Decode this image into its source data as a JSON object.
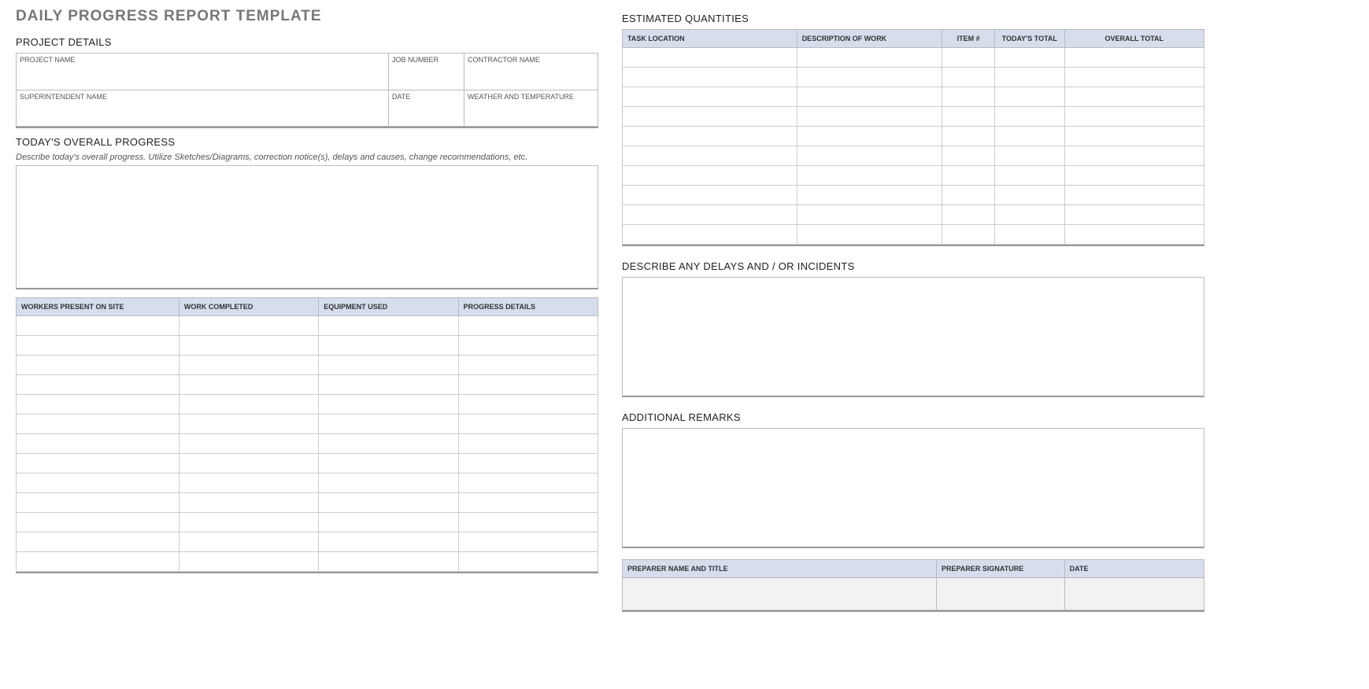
{
  "title": "DAILY PROGRESS REPORT TEMPLATE",
  "project_details": {
    "heading": "PROJECT DETAILS",
    "labels": {
      "project_name": "PROJECT NAME",
      "job_number": "JOB NUMBER",
      "contractor_name": "CONTRACTOR NAME",
      "superintendent_name": "SUPERINTENDENT NAME",
      "date": "DATE",
      "weather": "WEATHER AND TEMPERATURE"
    },
    "values": {
      "project_name": "",
      "job_number": "",
      "contractor_name": "",
      "superintendent_name": "",
      "date": "",
      "weather": ""
    }
  },
  "overall_progress": {
    "heading": "TODAY'S OVERALL PROGRESS",
    "instruction": "Describe today's overall progress.  Utilize Sketches/Diagrams, correction notice(s), delays and causes, change recommendations, etc.",
    "value": ""
  },
  "progress_table": {
    "headers": {
      "workers": "WORKERS PRESENT ON SITE",
      "completed": "WORK COMPLETED",
      "equipment": "EQUIPMENT USED",
      "details": "PROGRESS DETAILS"
    },
    "rows": [
      {
        "workers": "",
        "completed": "",
        "equipment": "",
        "details": ""
      },
      {
        "workers": "",
        "completed": "",
        "equipment": "",
        "details": ""
      },
      {
        "workers": "",
        "completed": "",
        "equipment": "",
        "details": ""
      },
      {
        "workers": "",
        "completed": "",
        "equipment": "",
        "details": ""
      },
      {
        "workers": "",
        "completed": "",
        "equipment": "",
        "details": ""
      },
      {
        "workers": "",
        "completed": "",
        "equipment": "",
        "details": ""
      },
      {
        "workers": "",
        "completed": "",
        "equipment": "",
        "details": ""
      },
      {
        "workers": "",
        "completed": "",
        "equipment": "",
        "details": ""
      },
      {
        "workers": "",
        "completed": "",
        "equipment": "",
        "details": ""
      },
      {
        "workers": "",
        "completed": "",
        "equipment": "",
        "details": ""
      },
      {
        "workers": "",
        "completed": "",
        "equipment": "",
        "details": ""
      },
      {
        "workers": "",
        "completed": "",
        "equipment": "",
        "details": ""
      },
      {
        "workers": "",
        "completed": "",
        "equipment": "",
        "details": ""
      }
    ]
  },
  "estimated_quantities": {
    "heading": "ESTIMATED QUANTITIES",
    "headers": {
      "location": "TASK LOCATION",
      "description": "DESCRIPTION OF WORK",
      "item": "ITEM #",
      "today": "TODAY'S TOTAL",
      "overall": "OVERALL TOTAL"
    },
    "rows": [
      {
        "location": "",
        "description": "",
        "item": "",
        "today": "",
        "overall": ""
      },
      {
        "location": "",
        "description": "",
        "item": "",
        "today": "",
        "overall": ""
      },
      {
        "location": "",
        "description": "",
        "item": "",
        "today": "",
        "overall": ""
      },
      {
        "location": "",
        "description": "",
        "item": "",
        "today": "",
        "overall": ""
      },
      {
        "location": "",
        "description": "",
        "item": "",
        "today": "",
        "overall": ""
      },
      {
        "location": "",
        "description": "",
        "item": "",
        "today": "",
        "overall": ""
      },
      {
        "location": "",
        "description": "",
        "item": "",
        "today": "",
        "overall": ""
      },
      {
        "location": "",
        "description": "",
        "item": "",
        "today": "",
        "overall": ""
      },
      {
        "location": "",
        "description": "",
        "item": "",
        "today": "",
        "overall": ""
      },
      {
        "location": "",
        "description": "",
        "item": "",
        "today": "",
        "overall": ""
      }
    ]
  },
  "delays": {
    "heading": "DESCRIBE ANY DELAYS AND / OR INCIDENTS",
    "value": ""
  },
  "remarks": {
    "heading": "ADDITIONAL REMARKS",
    "value": ""
  },
  "signature": {
    "headers": {
      "name": "PREPARER NAME AND TITLE",
      "sig": "PREPARER SIGNATURE",
      "date": "DATE"
    },
    "values": {
      "name": "",
      "sig": "",
      "date": ""
    }
  }
}
